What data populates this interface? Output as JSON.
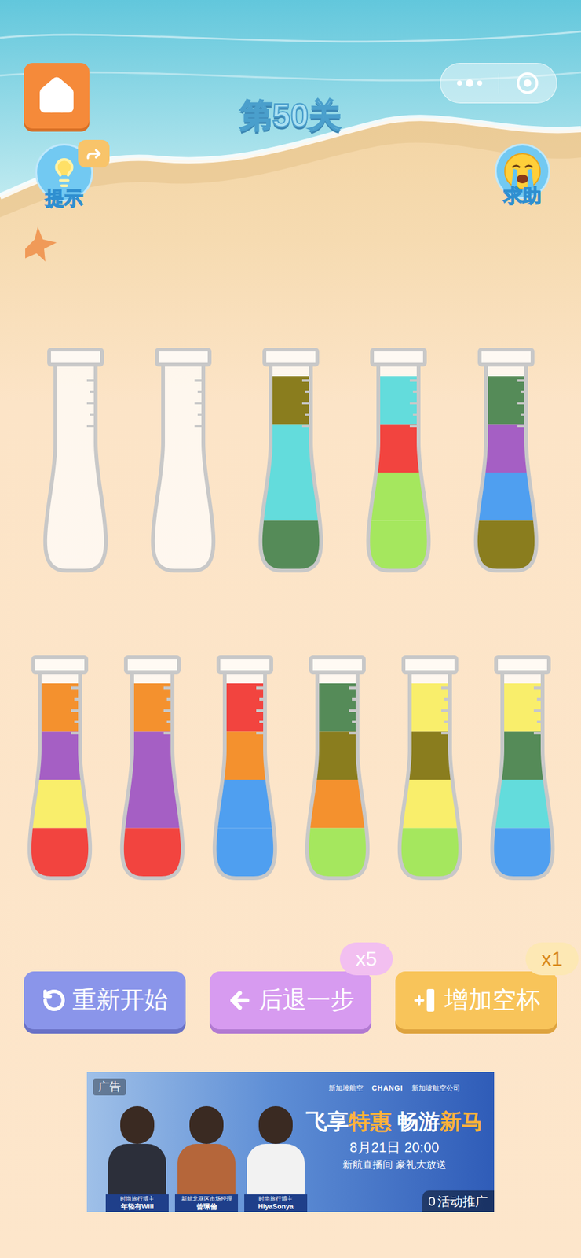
{
  "level_title": "第50关",
  "hint": {
    "label": "提示"
  },
  "help": {
    "label": "求助"
  },
  "tube_rows": [
    {
      "tubes": [
        {
          "layers": []
        },
        {
          "layers": []
        },
        {
          "layers": [
            {
              "color": "#8a7d1e"
            },
            {
              "color": "#63dcdc"
            },
            {
              "color": "#63dcdc"
            },
            {
              "color": "#558b58"
            }
          ]
        },
        {
          "layers": [
            {
              "color": "#63dcdc"
            },
            {
              "color": "#f2443f"
            },
            {
              "color": "#a5e75e"
            },
            {
              "color": "#a5e75e"
            }
          ]
        },
        {
          "layers": [
            {
              "color": "#558b58"
            },
            {
              "color": "#a55fc4"
            },
            {
              "color": "#4f9ff0"
            },
            {
              "color": "#8a7d1e"
            }
          ]
        }
      ]
    },
    {
      "tubes": [
        {
          "layers": [
            {
              "color": "#f4912e"
            },
            {
              "color": "#a55fc4"
            },
            {
              "color": "#f9ee6b"
            },
            {
              "color": "#f2443f"
            }
          ]
        },
        {
          "layers": [
            {
              "color": "#f4912e"
            },
            {
              "color": "#a55fc4"
            },
            {
              "color": "#a55fc4"
            },
            {
              "color": "#f2443f"
            }
          ]
        },
        {
          "layers": [
            {
              "color": "#f2443f"
            },
            {
              "color": "#f4912e"
            },
            {
              "color": "#4f9ff0"
            },
            {
              "color": "#4f9ff0"
            }
          ]
        },
        {
          "layers": [
            {
              "color": "#558b58"
            },
            {
              "color": "#8a7d1e"
            },
            {
              "color": "#f4912e"
            },
            {
              "color": "#a5e75e"
            }
          ]
        },
        {
          "layers": [
            {
              "color": "#f9ee6b"
            },
            {
              "color": "#8a7d1e"
            },
            {
              "color": "#f9ee6b"
            },
            {
              "color": "#a5e75e"
            }
          ]
        },
        {
          "layers": [
            {
              "color": "#f9ee6b"
            },
            {
              "color": "#558b58"
            },
            {
              "color": "#63dcdc"
            },
            {
              "color": "#4f9ff0"
            }
          ]
        }
      ]
    }
  ],
  "buttons": [
    {
      "label": "重新开始",
      "kind": "restart",
      "badge": ""
    },
    {
      "label": "后退一步",
      "kind": "undo",
      "badge": "x5"
    },
    {
      "label": "增加空杯",
      "kind": "add",
      "badge": "x1"
    }
  ],
  "ad": {
    "tag": "广告",
    "brands": [
      "新加坡航空",
      "CHANGI",
      "新加坡航空公司"
    ],
    "headline": [
      {
        "text": "飞享",
        "highlight": false
      },
      {
        "text": "特惠",
        "highlight": true
      },
      {
        "text": " 畅游",
        "highlight": false
      },
      {
        "text": "新马",
        "highlight": true
      }
    ],
    "date": "8月21日 20:00",
    "subline": "新航直播间 豪礼大放送",
    "people": [
      {
        "role": "时尚旅行博主",
        "name": "年轻有Will"
      },
      {
        "role": "新航北亚区市场经理",
        "name": "曾珮倫"
      },
      {
        "role": "时尚旅行博主",
        "name": "HiyaSonya"
      }
    ],
    "promo": "活动推广"
  }
}
